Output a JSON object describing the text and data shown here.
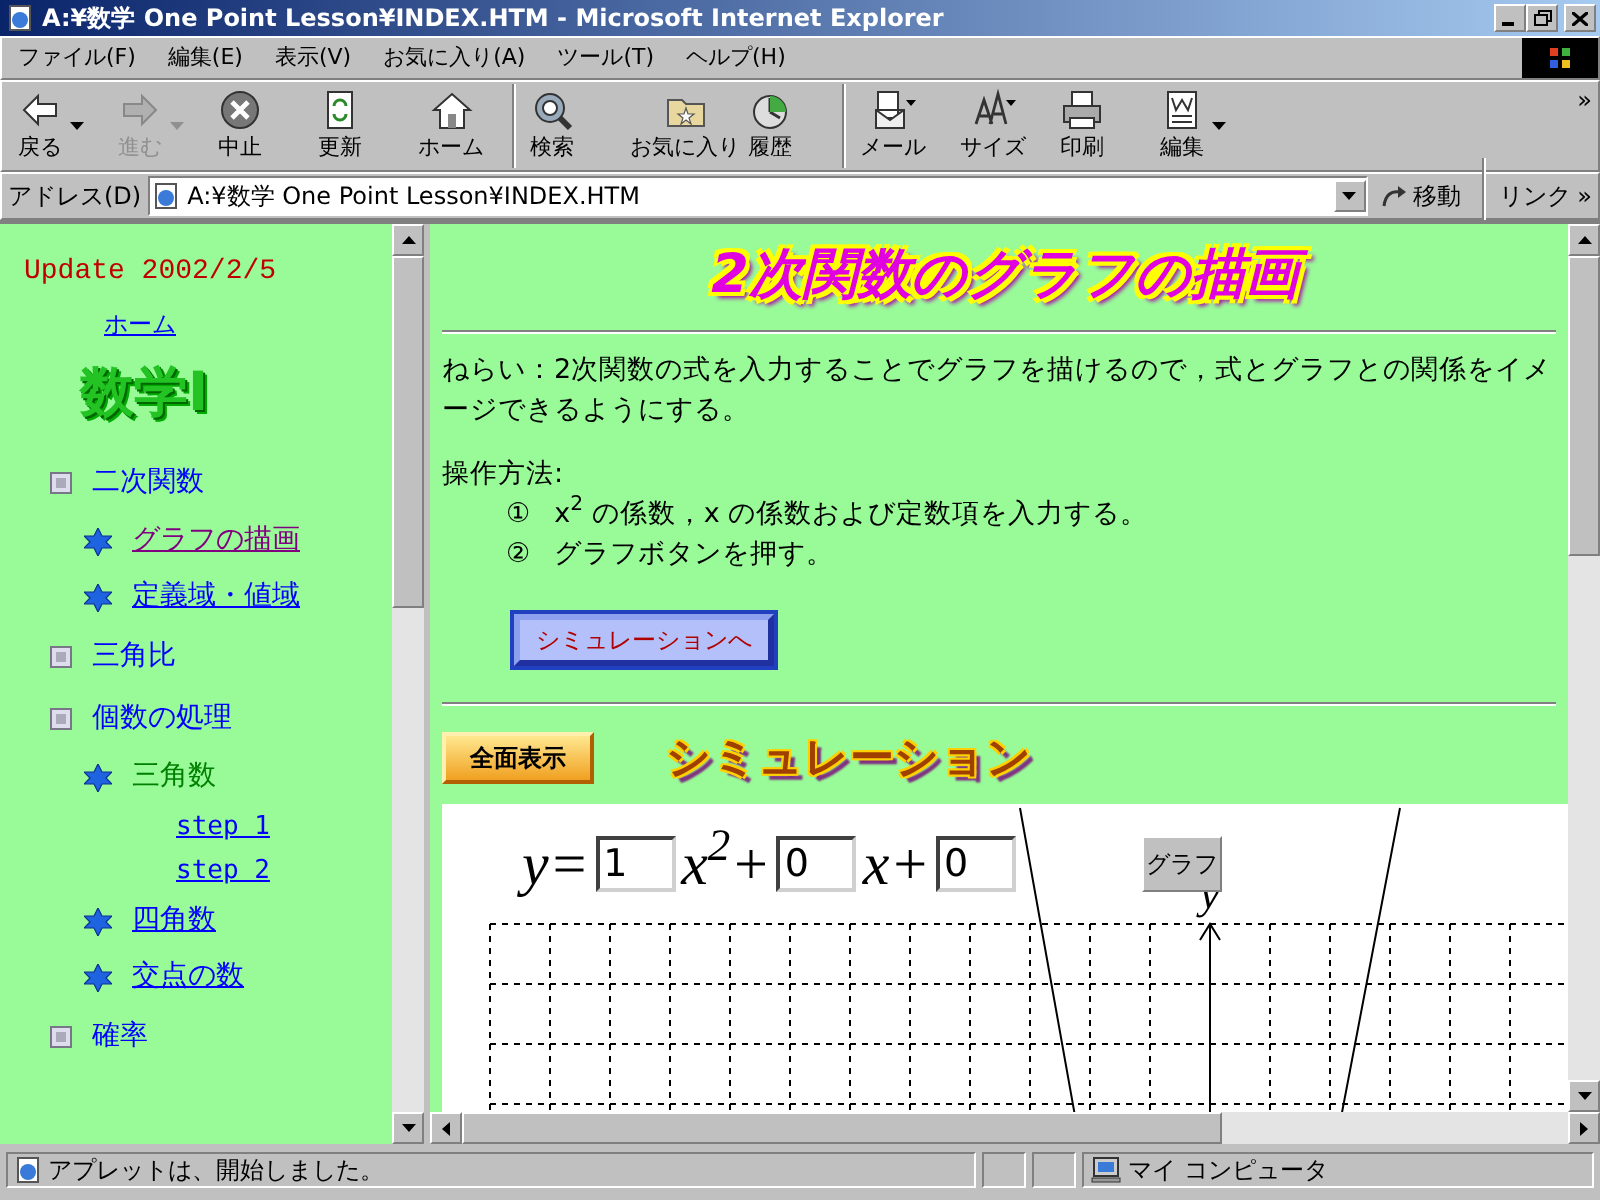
{
  "window": {
    "title": "A:¥数学 One Point Lesson¥INDEX.HTM - Microsoft Internet Explorer"
  },
  "menu": [
    "ファイル(F)",
    "編集(E)",
    "表示(V)",
    "お気に入り(A)",
    "ツール(T)",
    "ヘルプ(H)"
  ],
  "toolbar": [
    {
      "kind": "back",
      "label": "戻る",
      "disabled": false,
      "dropdown": true,
      "separator_after": false
    },
    {
      "kind": "forward",
      "label": "進む",
      "disabled": true,
      "dropdown": true,
      "separator_after": false
    },
    {
      "kind": "stop",
      "label": "中止",
      "disabled": false,
      "dropdown": false,
      "separator_after": false
    },
    {
      "kind": "refresh",
      "label": "更新",
      "disabled": false,
      "dropdown": false,
      "separator_after": false
    },
    {
      "kind": "home",
      "label": "ホーム",
      "disabled": false,
      "dropdown": false,
      "separator_after": true
    },
    {
      "kind": "search",
      "label": "検索",
      "disabled": false,
      "dropdown": false,
      "separator_after": false
    },
    {
      "kind": "favorites",
      "label": "お気に入り",
      "disabled": false,
      "dropdown": false,
      "separator_after": false
    },
    {
      "kind": "history",
      "label": "履歴",
      "disabled": false,
      "dropdown": false,
      "separator_after": true
    },
    {
      "kind": "mail",
      "label": "メール",
      "disabled": false,
      "dropdown": false,
      "separator_after": false
    },
    {
      "kind": "size",
      "label": "サイズ",
      "disabled": false,
      "dropdown": false,
      "separator_after": false
    },
    {
      "kind": "print",
      "label": "印刷",
      "disabled": false,
      "dropdown": false,
      "separator_after": false
    },
    {
      "kind": "edit",
      "label": "編集",
      "disabled": false,
      "dropdown": true,
      "separator_after": false
    }
  ],
  "toolbar_more": "»",
  "address": {
    "label": "アドレス(D)",
    "value": "A:¥数学 One Point Lesson¥INDEX.HTM",
    "go": "移動",
    "links": "リンク",
    "more": "»"
  },
  "sidebar": {
    "update": "Update 2002/2/5",
    "home": "ホーム",
    "logo": "数学Ⅰ",
    "items": [
      {
        "kind": "section",
        "label": "二次関数",
        "children": [
          {
            "kind": "topic",
            "label": "グラフの描画",
            "visited": true,
            "current": false
          },
          {
            "kind": "topic",
            "label": "定義域・値域",
            "visited": false,
            "current": false
          }
        ]
      },
      {
        "kind": "section",
        "label": "三角比"
      },
      {
        "kind": "section",
        "label": "個数の処理",
        "children": [
          {
            "kind": "topic",
            "label": "三角数",
            "visited": false,
            "current": true,
            "children": [
              {
                "kind": "step",
                "label": "step 1"
              },
              {
                "kind": "step",
                "label": "step 2"
              }
            ]
          },
          {
            "kind": "topic",
            "label": "四角数",
            "visited": false,
            "current": false
          },
          {
            "kind": "topic",
            "label": "交点の数",
            "visited": false,
            "current": false
          }
        ]
      },
      {
        "kind": "section",
        "label": "確率"
      }
    ]
  },
  "content": {
    "title": "2次関数のグラフの描画",
    "aim": "ねらい：2次関数の式を入力することでグラフを描けるので，式とグラフとの関係をイメージできるようにする。",
    "method_heading": "操作方法:",
    "steps": [
      {
        "number": "①",
        "text": "x$^{2}$ の係数，x の係数および定数項を入力する。"
      },
      {
        "number": "②",
        "text": "グラフボタンを押す。"
      }
    ],
    "simulation_link": "シミュレーションへ",
    "fullscreen_button": "全面表示",
    "simulation_heading": "シミュレーション",
    "equation": {
      "lead": "y=",
      "terms": [
        {
          "value": "1",
          "suffix": "x$^{2}$+"
        },
        {
          "value": "0",
          "suffix": "x+"
        },
        {
          "value": "0"
        }
      ],
      "button": "グラフ"
    },
    "graph": {
      "axis_label": "y"
    }
  },
  "status_bar": {
    "message": "アプレットは、開始しました。",
    "zone": "マイ コンピュータ"
  }
}
